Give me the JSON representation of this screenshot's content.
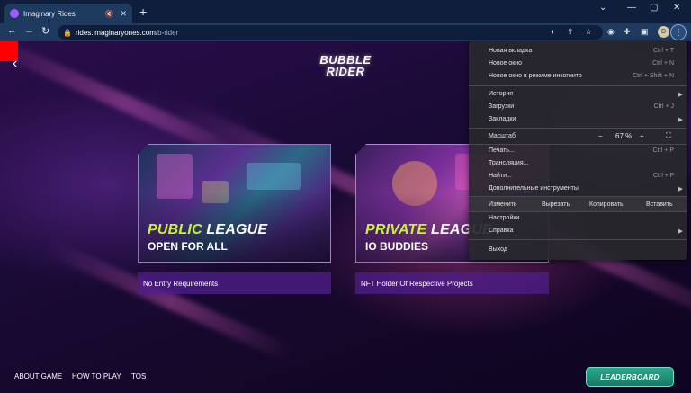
{
  "browser": {
    "tab_title": "Imaginary Rides",
    "url_host": "rides.imaginaryones.com",
    "url_path": "/b-rider",
    "profile_initial": "D"
  },
  "site": {
    "logo_line1": "BUBBLE",
    "logo_line2": "RIDER",
    "cards": [
      {
        "title_highlight": "PUBLIC",
        "title_rest": " LEAGUE",
        "subtitle": "OPEN FOR ALL",
        "requirement": "No Entry Requirements"
      },
      {
        "title_highlight": "PRIVATE",
        "title_rest": " LEAGUE",
        "subtitle": "IO BUDDIES",
        "requirement": "NFT Holder Of Respective Projects"
      }
    ],
    "footer_links": [
      "ABOUT GAME",
      "HOW TO PLAY",
      "TOS"
    ],
    "leaderboard_label": "LEADERBOARD"
  },
  "menu": {
    "items": [
      {
        "label": "Новая вкладка",
        "shortcut": "Ctrl + T"
      },
      {
        "label": "Новое окно",
        "shortcut": "Ctrl + N"
      },
      {
        "label": "Новое окно в режиме инкогнито",
        "shortcut": "Ctrl + Shift + N"
      },
      {
        "label": "История",
        "shortcut": ""
      },
      {
        "label": "Загрузки",
        "shortcut": "Ctrl + J"
      },
      {
        "label": "Закладки",
        "shortcut": ""
      },
      {
        "label": "Печать...",
        "shortcut": "Ctrl + P"
      },
      {
        "label": "Трансляция...",
        "shortcut": ""
      },
      {
        "label": "Найти...",
        "shortcut": "Ctrl + F"
      },
      {
        "label": "Дополнительные инструменты",
        "shortcut": ""
      },
      {
        "label": "Настройки",
        "shortcut": ""
      },
      {
        "label": "Справка",
        "shortcut": ""
      },
      {
        "label": "Выход",
        "shortcut": ""
      }
    ],
    "zoom_label": "Масштаб",
    "zoom_minus": "−",
    "zoom_value": "67 %",
    "zoom_plus": "+",
    "edit_label": "Изменить",
    "cut_label": "Вырезать",
    "copy_label": "Копировать",
    "paste_label": "Вставить"
  }
}
